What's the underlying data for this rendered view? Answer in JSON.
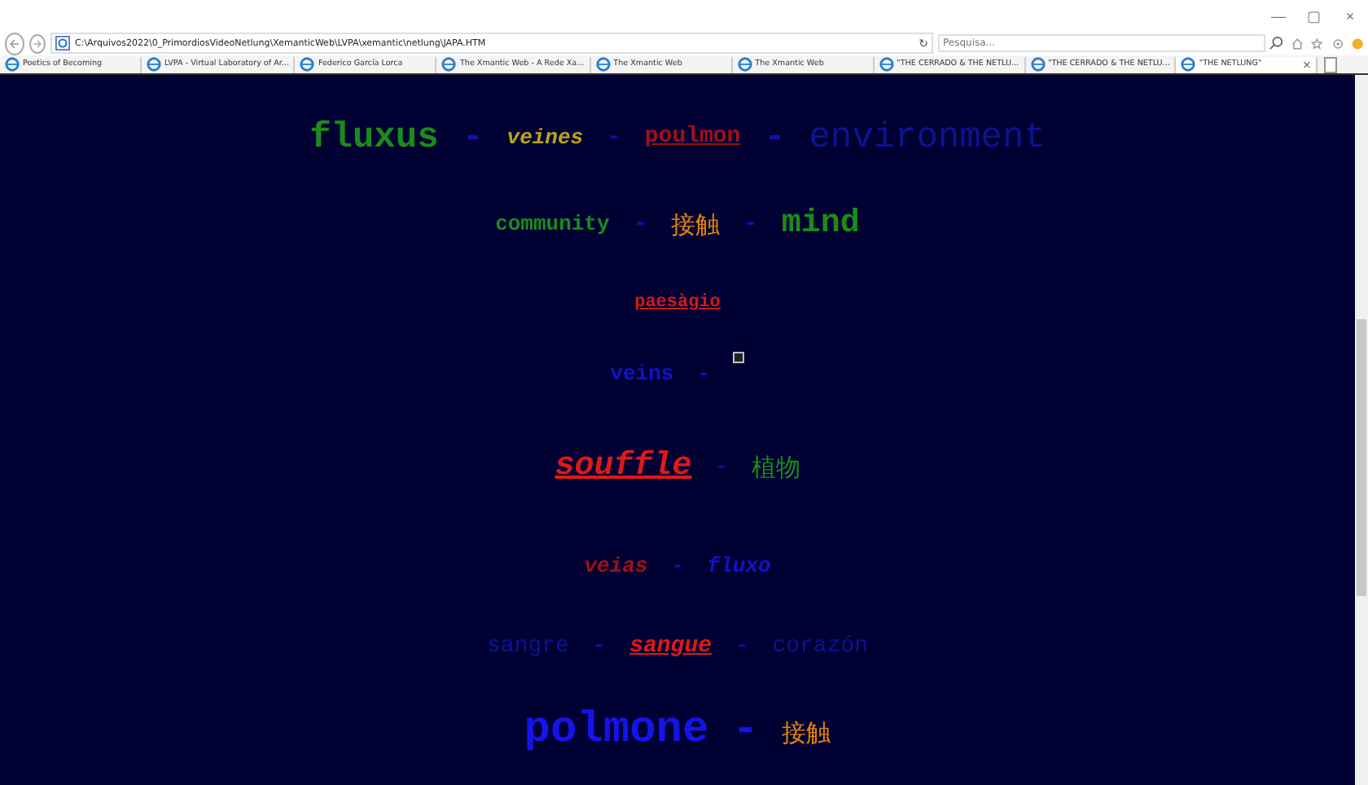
{
  "address_bar": {
    "url": "C:\\Arquivos2022\\0_PrimordiosVideoNetlung\\XemanticWeb\\LVPA\\xemantic\\netlung\\JAPA.HTM",
    "refresh": "↻",
    "search_placeholder": "Pesquisa..."
  },
  "window_controls": [
    "—",
    "▢",
    "×"
  ],
  "tabs": [
    {
      "label": "Poetics of Becoming",
      "selected": false
    },
    {
      "label": "LVPA - Virtual Laboratory of Ar...",
      "selected": false
    },
    {
      "label": "Federico García Lorca",
      "selected": false
    },
    {
      "label": "The Xmantic Web - A Rede Xa...",
      "selected": false
    },
    {
      "label": "The Xmantic Web",
      "selected": false
    },
    {
      "label": "The Xmantic Web",
      "selected": false
    },
    {
      "label": "\"THE CERRADO & THE NETLU...",
      "selected": false
    },
    {
      "label": "\"THE CERRADO & THE NETLU...",
      "selected": false
    },
    {
      "label": "\"THE NETLUNG\"",
      "selected": true
    }
  ],
  "tab_close": "×",
  "lines": [
    {
      "items": [
        {
          "kind": "word",
          "text": "fluxus",
          "color": "#1a8c1a"
        },
        {
          "kind": "dash",
          "text": "-",
          "color": "#0a14a8"
        },
        {
          "kind": "italic",
          "text": "veines",
          "color": "#b8a41c"
        },
        {
          "kind": "dash",
          "text": "-",
          "color": "#0a14a8"
        },
        {
          "kind": "link",
          "text": "poulmon",
          "color": "#a01018"
        },
        {
          "kind": "dash",
          "text": "-",
          "color": "#0a14a8"
        },
        {
          "kind": "plain",
          "text": "environment",
          "color": "#0c1490"
        }
      ]
    },
    {
      "items": [
        {
          "kind": "word",
          "text": "community",
          "color": "#1a8c1a"
        },
        {
          "kind": "dash",
          "text": "-",
          "color": "#0a14a8"
        },
        {
          "kind": "cjk",
          "text": "接触",
          "color": "#e0820e"
        },
        {
          "kind": "dash",
          "text": "-",
          "color": "#0a14a8"
        },
        {
          "kind": "word",
          "text": "mind",
          "color": "#1a8c1a"
        }
      ]
    },
    {
      "items": [
        {
          "kind": "link",
          "text": "paesàgio",
          "color": "#d81818"
        }
      ]
    },
    {
      "items": [
        {
          "kind": "word",
          "text": "veins",
          "color": "#1014c8"
        },
        {
          "kind": "dash",
          "text": "-",
          "color": "#1014c8"
        },
        {
          "kind": "image"
        }
      ]
    },
    {
      "items": [
        {
          "kind": "italiclink",
          "text": "souffle",
          "color": "#e01818"
        },
        {
          "kind": "dash",
          "text": "-",
          "color": "#0a14a8"
        },
        {
          "kind": "cjk",
          "text": "植物",
          "color": "#1a8c1a"
        }
      ]
    },
    {
      "items": [
        {
          "kind": "italic",
          "text": "veias",
          "color": "#a01018"
        },
        {
          "kind": "dash",
          "text": "-",
          "color": "#0a14a8"
        },
        {
          "kind": "italic",
          "text": "fluxo",
          "color": "#1014c8"
        }
      ]
    },
    {
      "items": [
        {
          "kind": "plain",
          "text": "sangre",
          "color": "#0c1490"
        },
        {
          "kind": "dash",
          "text": "-",
          "color": "#0c1490"
        },
        {
          "kind": "italiclink",
          "text": "sangue",
          "color": "#e01818"
        },
        {
          "kind": "dash",
          "text": "-",
          "color": "#0c1490"
        },
        {
          "kind": "plain",
          "text": "corazón",
          "color": "#0c1490"
        }
      ]
    },
    {
      "items": [
        {
          "kind": "word",
          "text": "polmone",
          "color": "#1414e8"
        },
        {
          "kind": "dash",
          "text": "-",
          "color": "#1414e8"
        },
        {
          "kind": "cjk",
          "text": "接触",
          "color": "#e0820e"
        }
      ]
    }
  ]
}
